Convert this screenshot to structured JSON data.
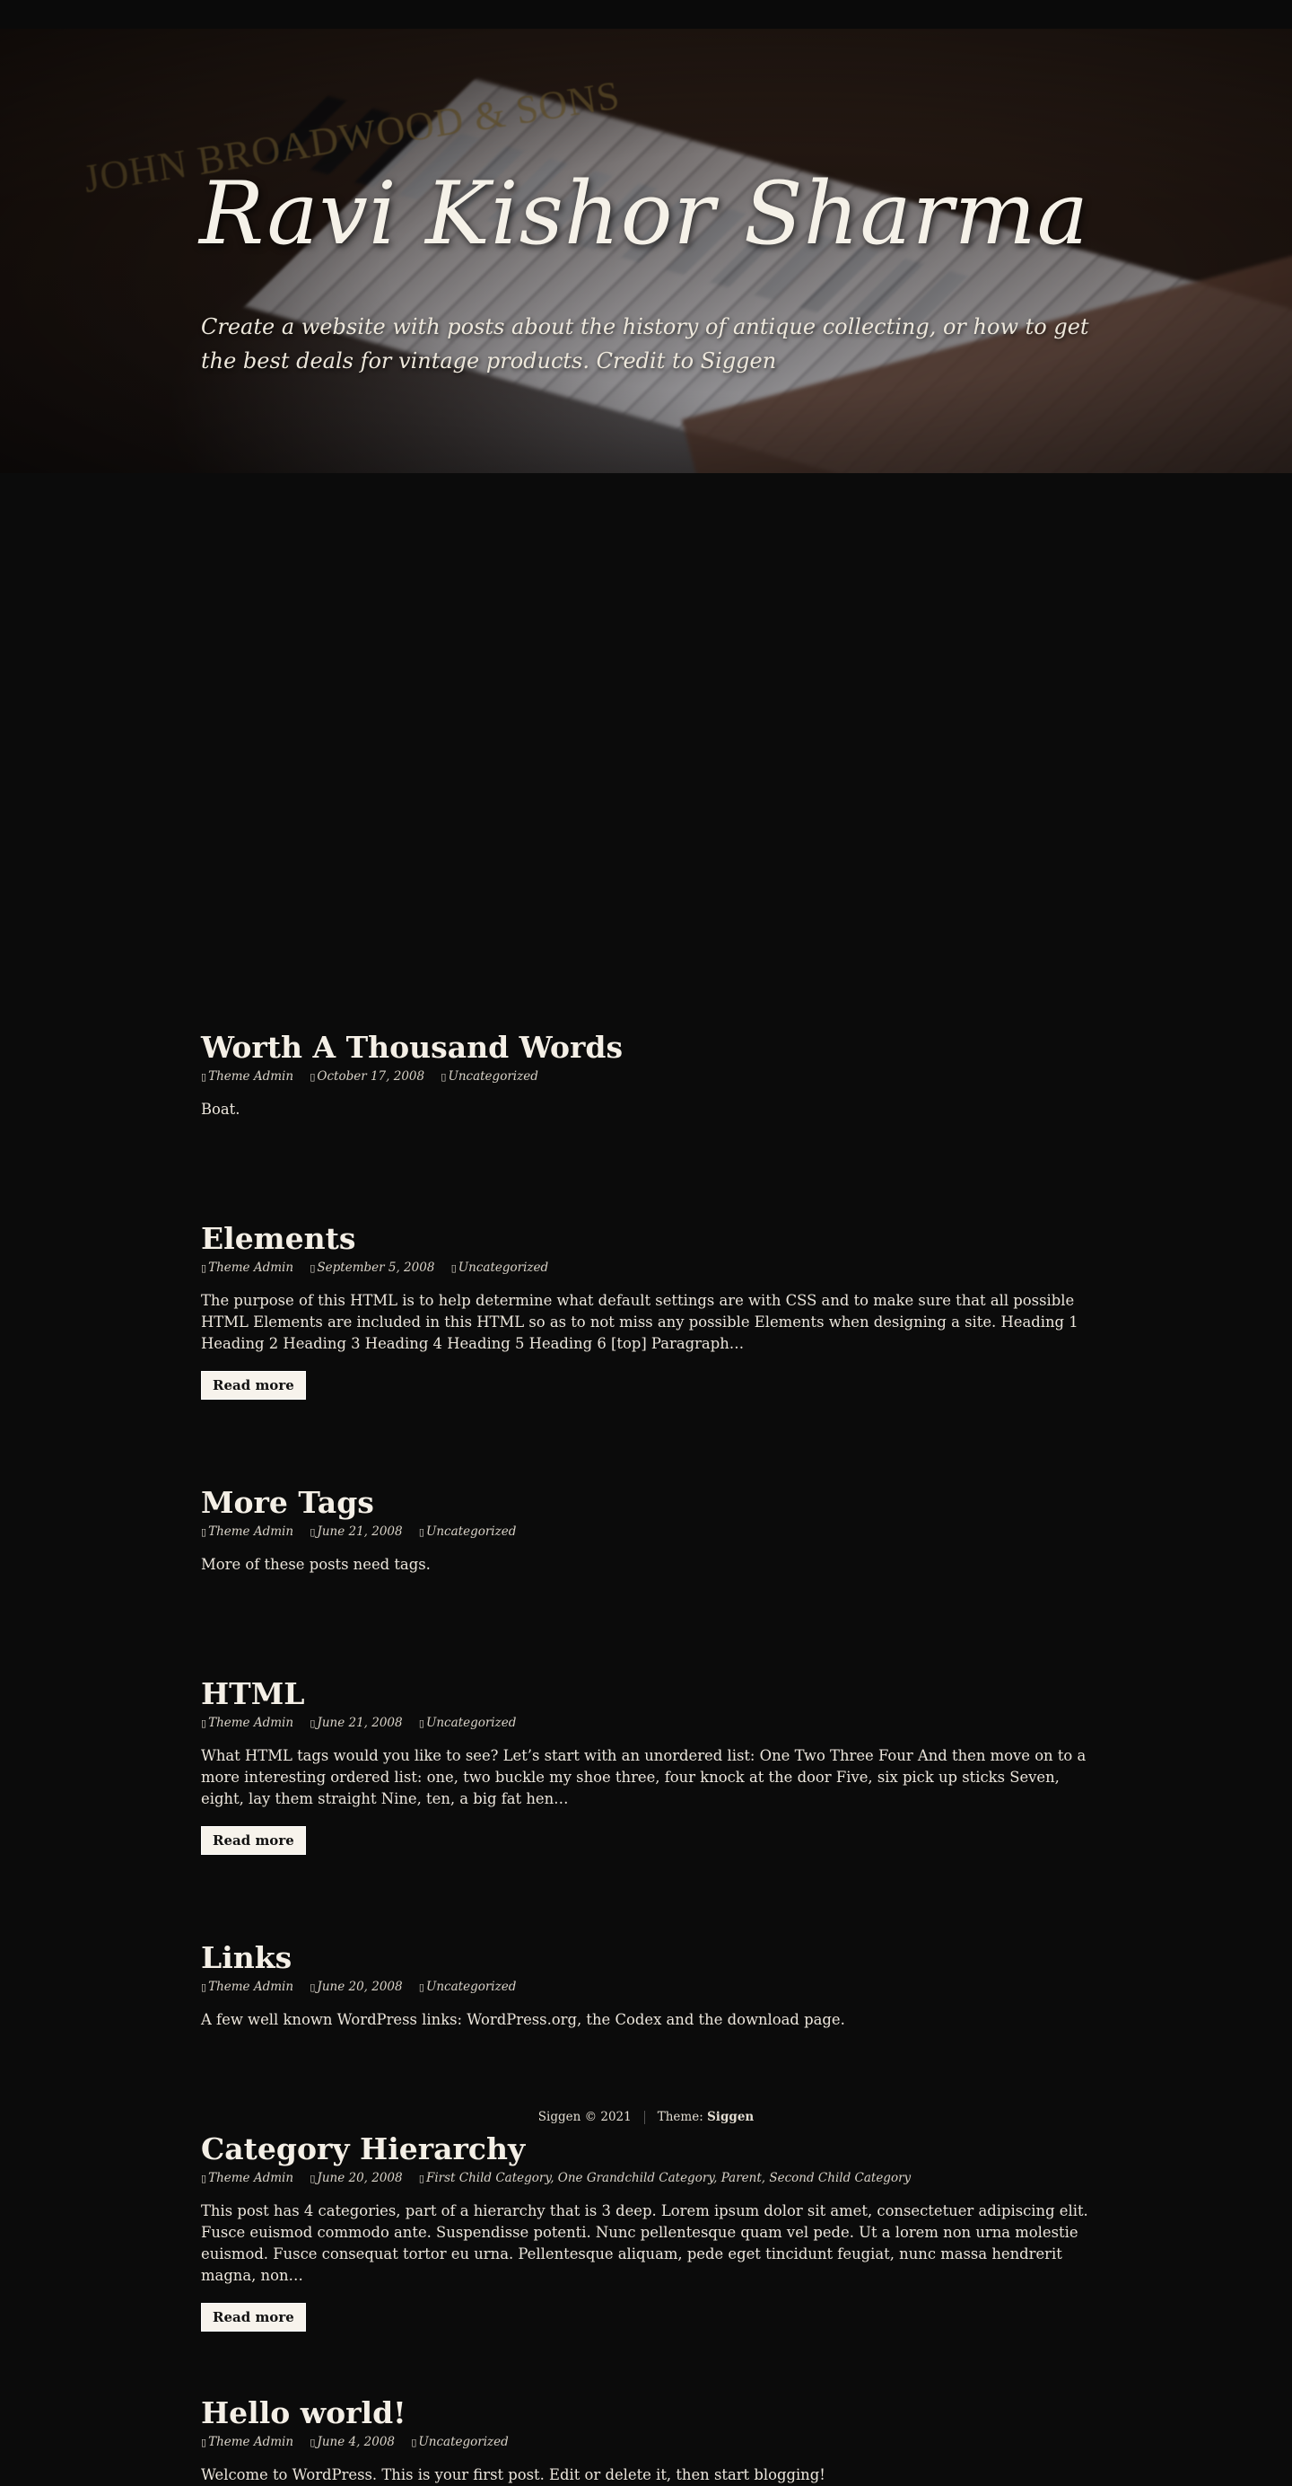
{
  "header": {
    "site_title": "Ravi Kishor Sharma",
    "site_description": "Create a website with posts about the history of antique collecting, or how to get the best deals for vintage products. Credit to Siggen",
    "image_brand_text": "JOHN BROADWOOD & SONS"
  },
  "posts": [
    {
      "title": "Worth A Thousand Words",
      "author": "Theme Admin",
      "date": "October 17, 2008",
      "categories": "Uncategorized",
      "excerpt": "Boat.",
      "read_more": ""
    },
    {
      "title": "Elements",
      "author": "Theme Admin",
      "date": "September 5, 2008",
      "categories": "Uncategorized",
      "excerpt": "The purpose of this HTML is to help determine what default settings are with CSS and to make sure that all possible HTML Elements are included in this HTML so as to not miss any possible Elements when designing a site. Heading 1 Heading 2 Heading 3 Heading 4 Heading 5 Heading 6 [top] Paragraph…",
      "read_more": "Read more"
    },
    {
      "title": "More Tags",
      "author": "Theme Admin",
      "date": "June 21, 2008",
      "categories": "Uncategorized",
      "excerpt": "More of these posts need tags.",
      "read_more": ""
    },
    {
      "title": "HTML",
      "author": "Theme Admin",
      "date": "June 21, 2008",
      "categories": "Uncategorized",
      "excerpt": "What HTML tags would you like to see? Let’s start with an unordered list: One Two Three Four And then move on to a more interesting ordered list: one, two buckle my shoe three, four knock at the door Five, six pick up sticks Seven, eight, lay them straight Nine, ten, a big fat hen…",
      "read_more": "Read more"
    },
    {
      "title": "Links",
      "author": "Theme Admin",
      "date": "June 20, 2008",
      "categories": "Uncategorized",
      "excerpt": "A few well known WordPress links: WordPress.org, the Codex and the download page.",
      "read_more": ""
    },
    {
      "title": "Category Hierarchy",
      "author": "Theme Admin",
      "date": "June 20, 2008",
      "categories": "First Child Category, One Grandchild Category, Parent, Second Child Category",
      "excerpt": "This post has 4 categories, part of a hierarchy that is 3 deep. Lorem ipsum dolor sit amet, consectetuer adipiscing elit. Fusce euismod commodo ante. Suspendisse potenti. Nunc pellentesque quam vel pede. Ut a lorem non urna molestie euismod. Fusce consequat tortor eu urna. Pellentesque aliquam, pede eget tincidunt feugiat, nunc massa hendrerit magna, non…",
      "read_more": "Read more"
    },
    {
      "title": "Hello world!",
      "author": "Theme Admin",
      "date": "June 4, 2008",
      "categories": "Uncategorized",
      "excerpt": "Welcome to WordPress. This is your first post. Edit or delete it, then start blogging!",
      "read_more": ""
    }
  ],
  "meta_icons": {
    "author": "user-icon",
    "date": "calendar-icon",
    "category": "folder-icon"
  },
  "footer": {
    "copyright": "Siggen © 2021",
    "theme_label": "Theme:",
    "theme_name": "Siggen"
  },
  "colors": {
    "background": "#0b0b0b",
    "text": "#e9e4da",
    "button_bg": "#f7f3ec"
  }
}
